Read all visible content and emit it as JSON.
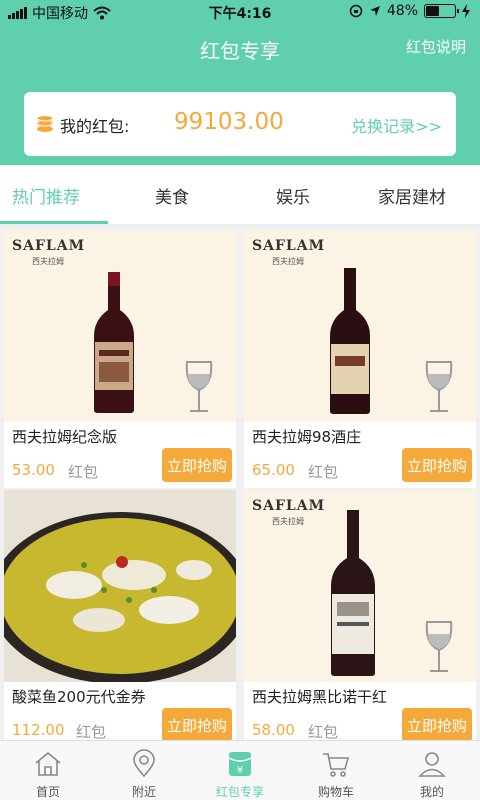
{
  "status_bar": {
    "carrier": "中国移动",
    "time": "下午4:16",
    "battery": "48%",
    "battery_level": 0.48
  },
  "nav": {
    "title": "红包专享",
    "help_link": "红包说明"
  },
  "balance": {
    "label": "我的红包:",
    "value": "99103.00",
    "history_link": "兑换记录>>"
  },
  "tabs": [
    {
      "label": "热门推荐",
      "active": true
    },
    {
      "label": "美食",
      "active": false
    },
    {
      "label": "娱乐",
      "active": false
    },
    {
      "label": "家居建材",
      "active": false
    }
  ],
  "brand": {
    "name": "SAFLAM",
    "sub": "西夫拉姆"
  },
  "products": [
    {
      "title": "西夫拉姆纪念版",
      "price": "53.00",
      "unit": "红包",
      "button": "立即抢购"
    },
    {
      "title": "西夫拉姆98酒庄",
      "price": "65.00",
      "unit": "红包",
      "button": "立即抢购"
    },
    {
      "title": "酸菜鱼200元代金券",
      "price": "112.00",
      "unit": "红包",
      "button": "立即抢购"
    },
    {
      "title": "西夫拉姆黑比诺干红",
      "price": "58.00",
      "unit": "红包",
      "button": "立即抢购"
    }
  ],
  "tabbar": [
    {
      "label": "首页",
      "icon": "home-icon",
      "active": false
    },
    {
      "label": "附近",
      "icon": "location-icon",
      "active": false
    },
    {
      "label": "红包专享",
      "icon": "red-packet-icon",
      "active": true
    },
    {
      "label": "购物车",
      "icon": "cart-icon",
      "active": false
    },
    {
      "label": "我的",
      "icon": "user-icon",
      "active": false
    }
  ],
  "colors": {
    "primary": "#5fcfae",
    "accent": "#f5a93b"
  }
}
